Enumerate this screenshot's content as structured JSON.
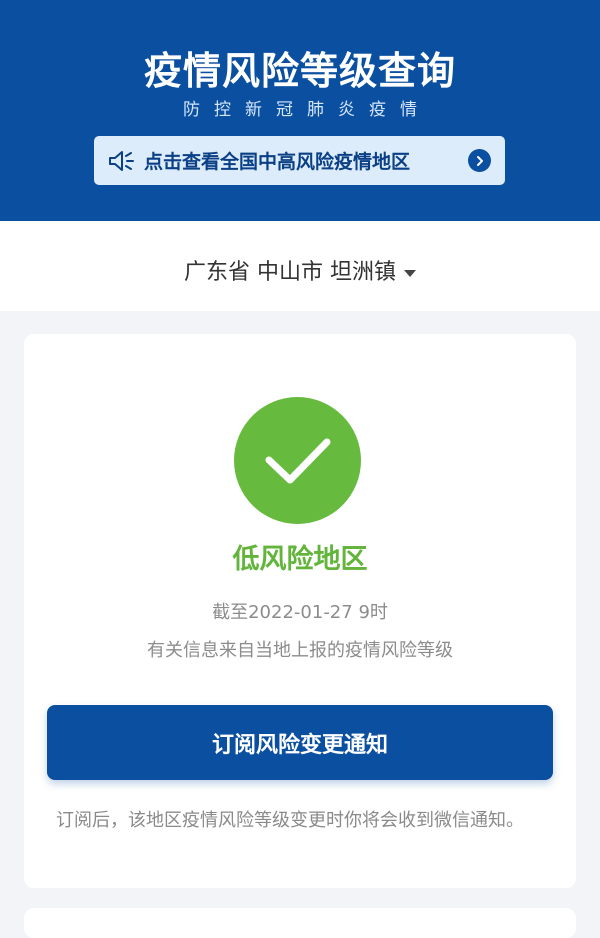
{
  "header": {
    "title": "疫情风险等级查询",
    "subtitle": "防控新冠肺炎疫情",
    "background_color": "#0b4fa0"
  },
  "banner": {
    "icon": "megaphone-icon",
    "text": "点击查看全国中高风险疫情地区",
    "arrow_icon": "chevron-right-circle-icon"
  },
  "location": {
    "text": "广东省 中山市 坦洲镇",
    "dropdown_icon": "caret-down-icon"
  },
  "result": {
    "icon": "checkmark-icon",
    "status": "低风险地区",
    "status_color": "#62b53a",
    "as_of": "截至2022-01-27 9时",
    "source": "有关信息来自当地上报的疫情风险等级"
  },
  "subscribe": {
    "button_label": "订阅风险变更通知",
    "note": "订阅后，该地区疫情风险等级变更时你将会收到微信通知。"
  }
}
